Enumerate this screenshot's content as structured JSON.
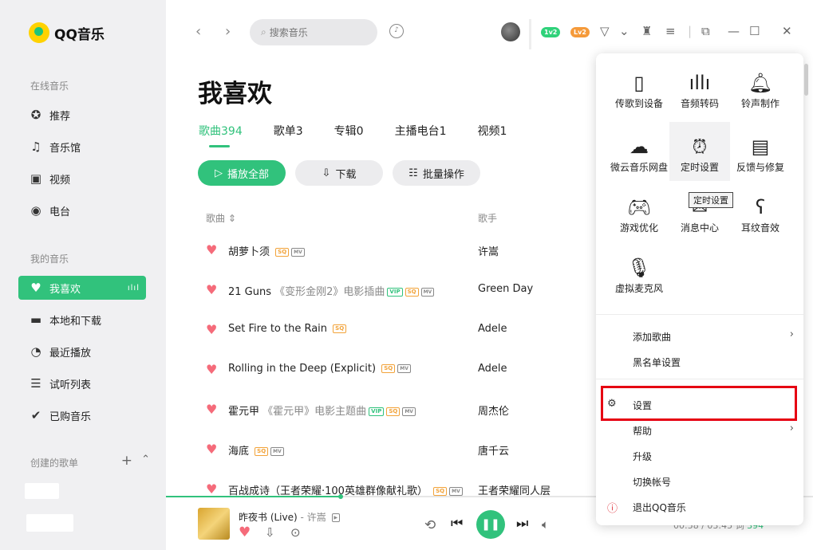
{
  "app": {
    "name": "QQ音乐"
  },
  "sidebar": {
    "online_title": "在线音乐",
    "online_items": [
      {
        "label": "推荐",
        "icon": "star-icon"
      },
      {
        "label": "音乐馆",
        "icon": "music-note-icon"
      },
      {
        "label": "视频",
        "icon": "video-icon"
      },
      {
        "label": "电台",
        "icon": "radio-icon"
      }
    ],
    "my_title": "我的音乐",
    "my_items": [
      {
        "label": "我喜欢",
        "icon": "heart-icon"
      },
      {
        "label": "本地和下载",
        "icon": "monitor-icon"
      },
      {
        "label": "最近播放",
        "icon": "clock-icon"
      },
      {
        "label": "试听列表",
        "icon": "playlist-icon"
      },
      {
        "label": "已购音乐",
        "icon": "check-circle-icon"
      }
    ],
    "created_title": "创建的歌单"
  },
  "header": {
    "search_placeholder": "搜索音乐",
    "badges": [
      {
        "label": "1v2",
        "color": "#2fd27a"
      },
      {
        "label": "Lv2",
        "color": "#f59a3a"
      }
    ]
  },
  "page": {
    "title": "我喜欢",
    "tabs": [
      {
        "label": "歌曲394",
        "active": true
      },
      {
        "label": "歌单3"
      },
      {
        "label": "专辑0"
      },
      {
        "label": "主播电台1"
      },
      {
        "label": "视频1"
      }
    ],
    "actions": {
      "play_all": "播放全部",
      "download": "下载",
      "batch": "批量操作"
    },
    "columns": {
      "song": "歌曲",
      "artist": "歌手"
    },
    "songs": [
      {
        "title": "胡萝卜须",
        "subtitle": "",
        "tags": [
          "SQ",
          "MV"
        ],
        "artist": "许嵩"
      },
      {
        "title": "21 Guns",
        "subtitle": "《变形金刚2》电影插曲",
        "tags": [
          "VIP",
          "SQ",
          "MV"
        ],
        "artist": "Green Day"
      },
      {
        "title": "Set Fire to the Rain",
        "subtitle": "",
        "tags": [
          "SQ"
        ],
        "artist": "Adele"
      },
      {
        "title": "Rolling in the Deep (Explicit)",
        "subtitle": "",
        "tags": [
          "SQ",
          "MV"
        ],
        "artist": "Adele"
      },
      {
        "title": "霍元甲",
        "subtitle": "《霍元甲》电影主题曲",
        "tags": [
          "VIP",
          "SQ",
          "MV"
        ],
        "artist": "周杰伦"
      },
      {
        "title": "海底",
        "subtitle": "",
        "tags": [
          "SQ",
          "MV"
        ],
        "artist": "唐千云"
      },
      {
        "title": "百战成诗（王者荣耀·100英雄群像献礼歌）",
        "subtitle": "",
        "tags": [
          "SQ",
          "MV"
        ],
        "artist": "王者荣耀同人层"
      }
    ]
  },
  "player": {
    "title": "昨夜书 (Live)",
    "artist": "许嵩",
    "separator": "-",
    "progress": 0.27,
    "time": "00:58 / 03:45",
    "extra": "词",
    "count": "394"
  },
  "popup": {
    "grid": [
      {
        "label": "传歌到设备",
        "icon": "phone-icon"
      },
      {
        "label": "音频转码",
        "icon": "waveform-icon"
      },
      {
        "label": "铃声制作",
        "icon": "bell-icon"
      },
      {
        "label": "微云音乐网盘",
        "icon": "cloud-icon"
      },
      {
        "label": "定时设置",
        "icon": "alarm-clock-icon"
      },
      {
        "label": "反馈与修复",
        "icon": "feedback-icon"
      },
      {
        "label": "游戏优化",
        "icon": "gamepad-icon"
      },
      {
        "label": "消息中心",
        "icon": "message-icon"
      },
      {
        "label": "耳纹音效",
        "icon": "ear-icon"
      },
      {
        "label": "虚拟麦克风",
        "icon": "microphone-icon"
      }
    ],
    "tooltip": "定时设置",
    "menu": [
      {
        "label": "添加歌曲",
        "chevron": true
      },
      {
        "label": "黑名单设置"
      },
      {
        "label": "设置",
        "icon": "gear-icon"
      },
      {
        "label": "帮助",
        "chevron": true
      },
      {
        "label": "升级"
      },
      {
        "label": "切换帐号"
      },
      {
        "label": "退出QQ音乐",
        "icon": "exit-icon"
      }
    ]
  }
}
